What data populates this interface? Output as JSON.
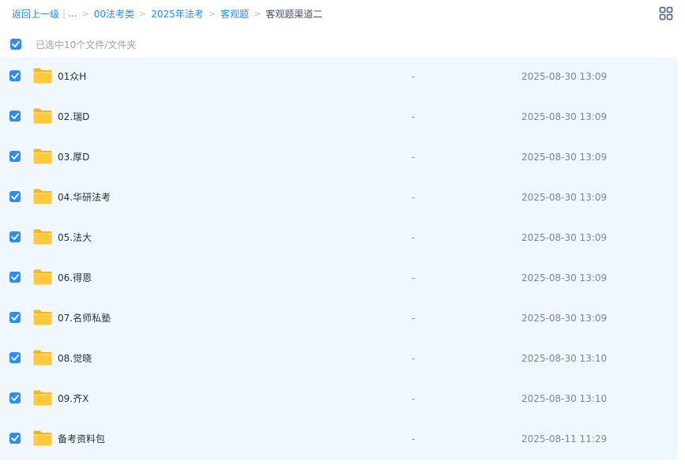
{
  "breadcrumb": {
    "back_label": "返回上一级",
    "pipe": "|",
    "ellipsis": "...",
    "separator": ">",
    "items": [
      "00法考类",
      "2025年法考",
      "客观题"
    ],
    "current": "客观题渠道二"
  },
  "view_toggle_icon": "grid-view-icon",
  "selection": {
    "label": "已选中10个文件/文件夹",
    "all_checked": true
  },
  "colors": {
    "accent": "#2b8ef0",
    "list_background": "#f0f7fe",
    "folder": "#ffc93c"
  },
  "files": [
    {
      "name": "01众H",
      "size": "-",
      "date": "2025-08-30 13:09",
      "checked": true
    },
    {
      "name": "02.瑞D",
      "size": "-",
      "date": "2025-08-30 13:09",
      "checked": true
    },
    {
      "name": "03.厚D",
      "size": "-",
      "date": "2025-08-30 13:09",
      "checked": true
    },
    {
      "name": "04.华研法考",
      "size": "-",
      "date": "2025-08-30 13:09",
      "checked": true
    },
    {
      "name": "05.法大",
      "size": "-",
      "date": "2025-08-30 13:09",
      "checked": true
    },
    {
      "name": "06.得恩",
      "size": "-",
      "date": "2025-08-30 13:09",
      "checked": true
    },
    {
      "name": "07.名师私塾",
      "size": "-",
      "date": "2025-08-30 13:09",
      "checked": true
    },
    {
      "name": "08.觉晓",
      "size": "-",
      "date": "2025-08-30 13:10",
      "checked": true
    },
    {
      "name": "09.齐X",
      "size": "-",
      "date": "2025-08-30 13:10",
      "checked": true
    },
    {
      "name": "备考资料包",
      "size": "-",
      "date": "2025-08-11 11:29",
      "checked": true
    }
  ]
}
